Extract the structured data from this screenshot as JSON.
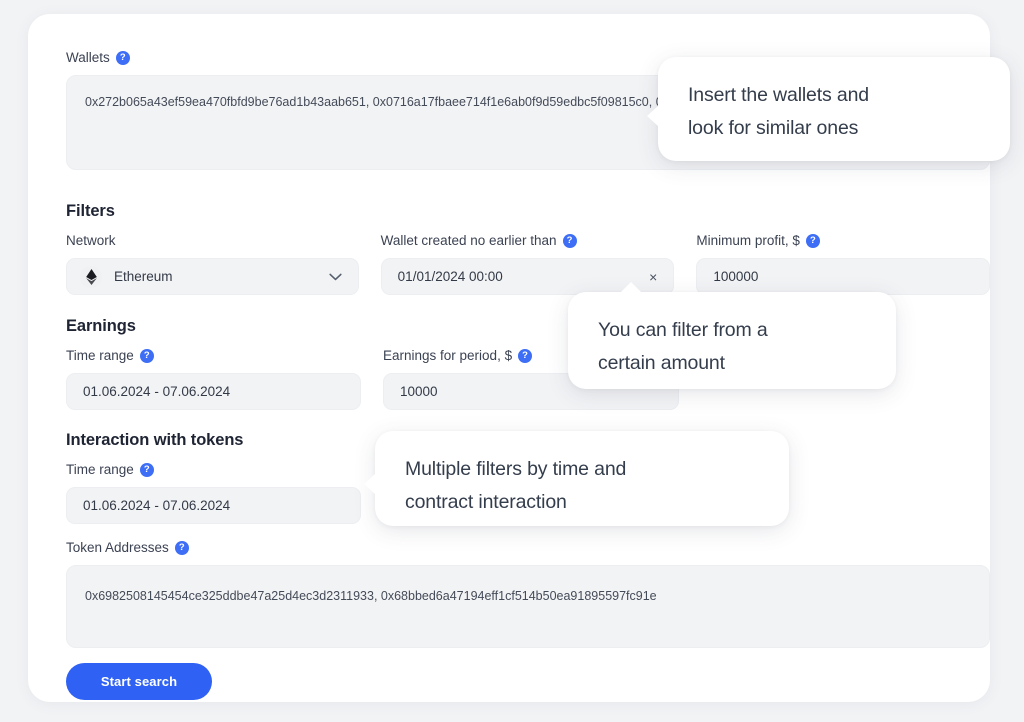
{
  "wallets": {
    "label": "Wallets",
    "help": "?",
    "value": "0x272b065a43ef59ea470fbfd9be76ad1b43aab651, 0x0716a17fbaee714f1e6ab0f9d59edbc5f09815c0, 0xcb8efb0c065071e4110932858a84365a80c8fef0"
  },
  "filters": {
    "title": "Filters",
    "network": {
      "label": "Network",
      "value": "Ethereum",
      "icon": "ethereum-icon",
      "chevron": "chevron-down-icon"
    },
    "wallet_created": {
      "label": "Wallet created no earlier than",
      "help": "?",
      "value": "01/01/2024 00:00",
      "clear": "×"
    },
    "minimum_profit": {
      "label": "Minimum profit, $",
      "help": "?",
      "value": "100000"
    }
  },
  "earnings": {
    "title": "Earnings",
    "time_range": {
      "label": "Time range",
      "help": "?",
      "value": "01.06.2024 - 07.06.2024"
    },
    "period_amount": {
      "label": "Earnings for period, $",
      "help": "?",
      "value": "10000"
    }
  },
  "interaction": {
    "title": "Interaction with tokens",
    "time_range": {
      "label": "Time range",
      "help": "?",
      "value": "01.06.2024 - 07.06.2024"
    }
  },
  "tokens": {
    "label": "Token Addresses",
    "help": "?",
    "value": "0x6982508145454ce325ddbe47a25d4ec3d2311933, 0x68bbed6a47194eff1cf514b50ea91895597fc91e"
  },
  "actions": {
    "start_search": "Start search"
  },
  "callouts": [
    {
      "line1": "Insert the wallets and",
      "line2": "look for similar ones"
    },
    {
      "line1": "You can filter from a",
      "line2": "certain amount"
    },
    {
      "line1": "Multiple filters by time and",
      "line2": "contract interaction"
    }
  ],
  "colors": {
    "accent": "#2f62f4",
    "help_badge": "#3d6ef5",
    "page_bg": "#f2f3f5",
    "card_bg": "#ffffff",
    "input_bg": "#f2f3f5"
  }
}
